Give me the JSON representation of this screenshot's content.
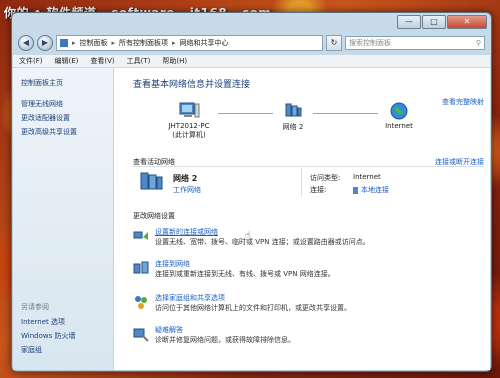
{
  "watermark": "你的 • 软件频道 - software - it168 - com",
  "window": {
    "controls": {
      "minimize": "—",
      "maximize": "□",
      "close": "✕"
    }
  },
  "address_bar": {
    "back": "◀",
    "forward": "▶",
    "crumbs": [
      "控制面板",
      "所有控制面板项",
      "网络和共享中心"
    ],
    "search_placeholder": "搜索控制面板",
    "refresh": "↻"
  },
  "menu": [
    "文件(F)",
    "编辑(E)",
    "查看(V)",
    "工具(T)",
    "帮助(H)"
  ],
  "sidebar": {
    "items": [
      "控制面板主页",
      "管理无线网络",
      "更改适配器设置",
      "更改高级共享设置"
    ],
    "see_also_title": "另请参阅",
    "see_also": [
      "Internet 选项",
      "Windows 防火墙",
      "家庭组"
    ]
  },
  "main": {
    "title": "查看基本网络信息并设置连接",
    "view_full_map": "查看完整映射",
    "map": {
      "pc_name": "JHT2012-PC",
      "pc_sub": "(此计算机)",
      "network": "网络 2",
      "internet": "Internet"
    },
    "active_title": "查看活动网络",
    "connect_disconnect": "连接或断开连接",
    "active": {
      "name": "网络 2",
      "type": "工作网络",
      "access_label": "访问类型:",
      "access_value": "Internet",
      "conn_label": "连接:",
      "conn_value": "本地连接"
    },
    "change_title": "更改网络设置",
    "tasks": [
      {
        "name": "设置新的连接或网络",
        "desc": "设置无线、宽带、拨号、临时或 VPN 连接；或设置路由器或访问点。"
      },
      {
        "name": "连接到网络",
        "desc": "连接到或重新连接到无线、有线、拨号或 VPN 网络连接。"
      },
      {
        "name": "选择家庭组和共享选项",
        "desc": "访问位于其他网络计算机上的文件和打印机，或更改共享设置。"
      },
      {
        "name": "疑难解答",
        "desc": "诊断并修复网络问题，或获得故障排除信息。"
      }
    ]
  },
  "colors": {
    "link": "#1a5fc0",
    "title": "#1e3f7a"
  }
}
